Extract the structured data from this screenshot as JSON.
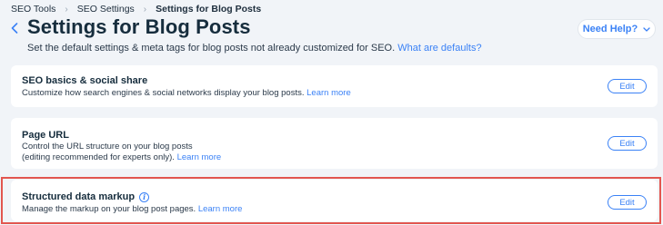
{
  "breadcrumb": {
    "items": [
      "SEO Tools",
      "SEO Settings",
      "Settings for Blog Posts"
    ]
  },
  "header": {
    "title": "Settings for Blog Posts",
    "subtitle": "Set the default settings & meta tags for blog posts not already customized for SEO.",
    "subtitle_link": "What are defaults?",
    "help_label": "Need Help?"
  },
  "cards": [
    {
      "title": "SEO basics & social share",
      "desc_line1": "Customize how search engines & social networks display your blog posts.",
      "link": "Learn more",
      "edit_label": "Edit"
    },
    {
      "title": "Page URL",
      "desc_line1": "Control the URL structure on your blog posts",
      "desc_line2": "(editing recommended for experts only).",
      "link": "Learn more",
      "edit_label": "Edit"
    },
    {
      "title": "Structured data markup",
      "desc_line1": "Manage the markup on your blog post pages.",
      "link": "Learn more",
      "edit_label": "Edit"
    }
  ],
  "icons": [
    "back-chevron-icon",
    "chevron-right-icon",
    "chevron-down-icon",
    "info-icon"
  ],
  "colors": {
    "accent": "#3b82f6",
    "background": "#f1f4f8",
    "highlight": "#e2564f"
  }
}
